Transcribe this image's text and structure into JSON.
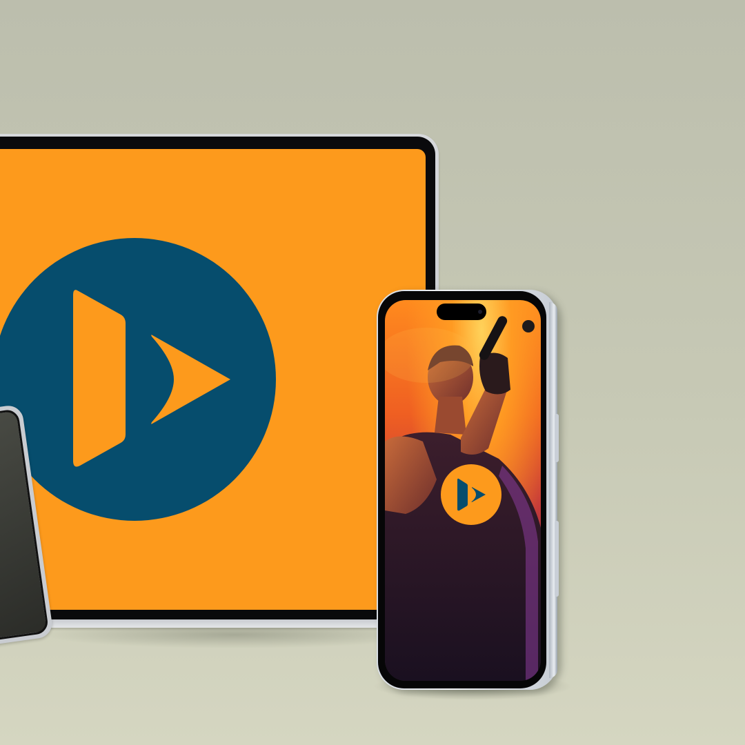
{
  "scene": {
    "description_tags": [
      "monitor",
      "phone",
      "tablet"
    ],
    "background_color": "#c4c6b2"
  },
  "brand": {
    "logo_icon": "play-logo-icon",
    "primary_color": "#fd9a1c",
    "secondary_color": "#064d6d"
  },
  "phone_screen": {
    "content_icon": "performer-photo",
    "overlay_icon": "play-logo-icon"
  }
}
